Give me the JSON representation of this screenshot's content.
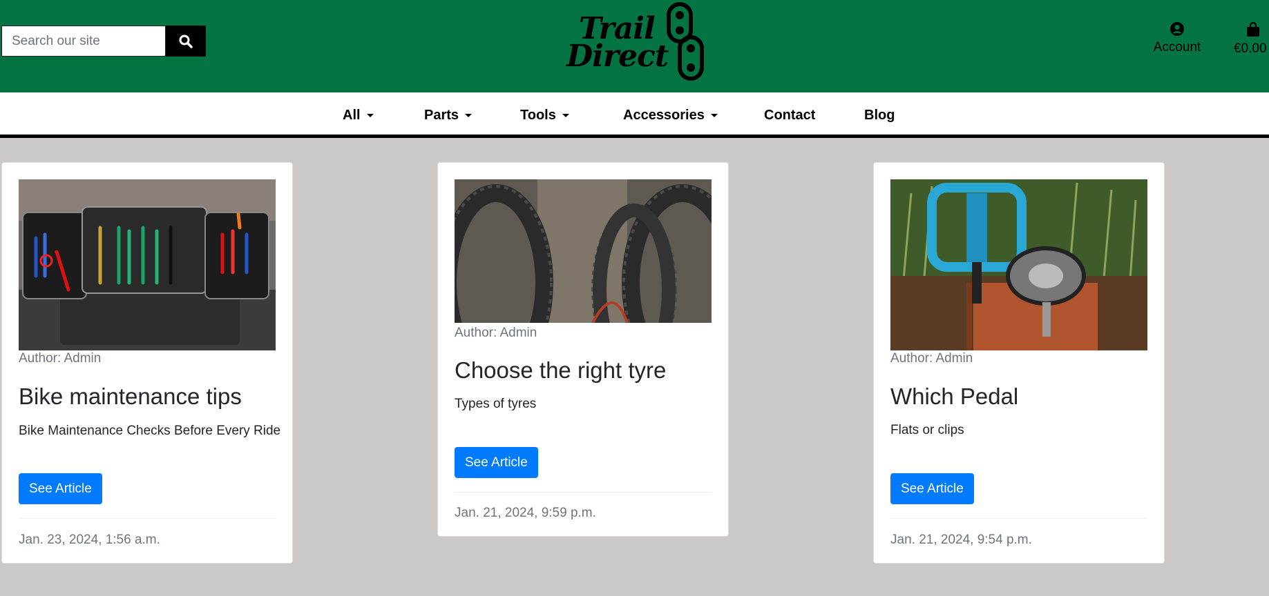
{
  "search": {
    "placeholder": "Search our site",
    "icon": "search-icon"
  },
  "brand": {
    "line1": "Trail",
    "line2": "Direct"
  },
  "header": {
    "account_label": "Account",
    "bag_total": "€0.00"
  },
  "nav": {
    "all": "All",
    "parts": "Parts",
    "tools": "Tools",
    "accessories": "Accessories",
    "contact": "Contact",
    "blog": "Blog"
  },
  "posts": [
    {
      "author": "Author: Admin",
      "title": "Bike maintenance tips",
      "description": "Bike Maintenance Checks Before Every Ride",
      "button": "See Article",
      "date": "Jan. 23, 2024, 1:56 a.m."
    },
    {
      "author": "Author: Admin",
      "title": "Choose the right tyre",
      "description": "Types of tyres",
      "button": "See Article",
      "date": "Jan. 21, 2024, 9:59 p.m."
    },
    {
      "author": "Author: Admin",
      "title": "Which Pedal",
      "description": "Flats or clips",
      "button": "See Article",
      "date": "Jan. 21, 2024, 9:54 p.m."
    }
  ],
  "colors": {
    "header_bg": "#057443",
    "page_bg": "#ccc8c8",
    "button": "#007bff"
  }
}
